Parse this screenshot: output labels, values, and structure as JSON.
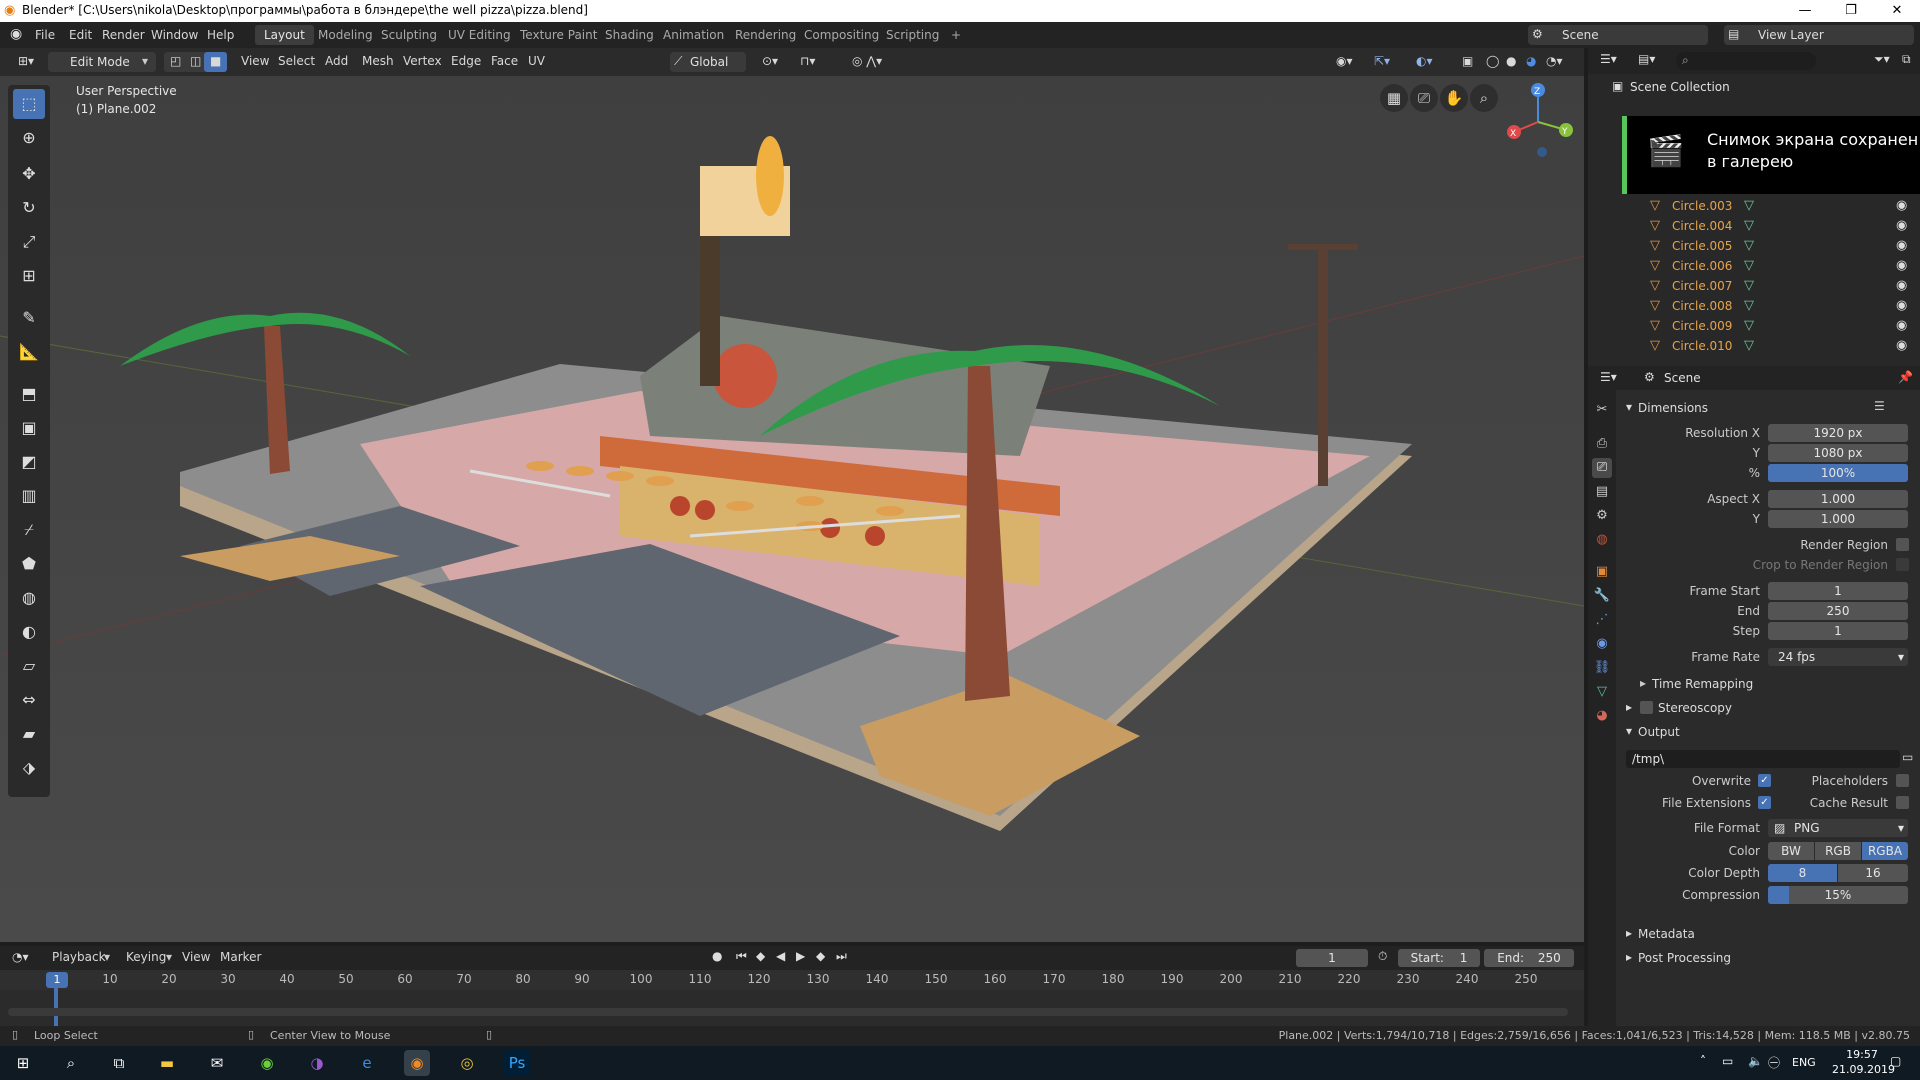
{
  "window": {
    "title": "Blender* [C:\\Users\\nikola\\Desktop\\программы\\работа в блэндере\\the well pizza\\pizza.blend]",
    "minimize": "—",
    "maximize": "❐",
    "close": "✕"
  },
  "topbar": {
    "menus": [
      "File",
      "Edit",
      "Render",
      "Window",
      "Help"
    ],
    "workspaces": [
      "Layout",
      "Modeling",
      "Sculpting",
      "UV Editing",
      "Texture Paint",
      "Shading",
      "Animation",
      "Rendering",
      "Compositing",
      "Scripting"
    ],
    "add_workspace": "+",
    "scene_label": "Scene",
    "view_layer_label": "View Layer"
  },
  "viewport_header": {
    "mode": "Edit Mode",
    "menus": [
      "View",
      "Select",
      "Add",
      "Mesh",
      "Vertex",
      "Edge",
      "Face",
      "UV"
    ],
    "orientation": "Global"
  },
  "viewport": {
    "perspective": "User Perspective",
    "object": "(1) Plane.002",
    "gizmo": {
      "x": "X",
      "y": "Y",
      "z": "Z"
    }
  },
  "outliner": {
    "title": "Scene Collection",
    "items": [
      "Circle.003",
      "Circle.004",
      "Circle.005",
      "Circle.006",
      "Circle.007",
      "Circle.008",
      "Circle.009",
      "Circle.010"
    ]
  },
  "toast": {
    "line1": "Снимок экрана сохранен",
    "line2": "в галерею"
  },
  "properties": {
    "context": "Scene",
    "dimensions": {
      "title": "Dimensions",
      "resolution_x_label": "Resolution X",
      "resolution_x": "1920 px",
      "y_label": "Y",
      "resolution_y": "1080 px",
      "percent_label": "%",
      "percent": "100%",
      "aspect_x_label": "Aspect X",
      "aspect_x": "1.000",
      "aspect_y": "1.000",
      "render_region": "Render Region",
      "crop_region": "Crop to Render Region",
      "frame_start_label": "Frame Start",
      "frame_start": "1",
      "end_label": "End",
      "frame_end": "250",
      "step_label": "Step",
      "step": "1",
      "frame_rate_label": "Frame Rate",
      "frame_rate": "24 fps",
      "time_remapping": "Time Remapping"
    },
    "stereoscopy": "Stereoscopy",
    "output": {
      "title": "Output",
      "path": "/tmp\\",
      "overwrite": "Overwrite",
      "placeholders": "Placeholders",
      "file_extensions": "File Extensions",
      "cache_result": "Cache Result",
      "file_format_label": "File Format",
      "file_format": "PNG",
      "color_label": "Color",
      "color_options": [
        "BW",
        "RGB",
        "RGBA"
      ],
      "color_depth_label": "Color Depth",
      "color_depth_options": [
        "8",
        "16"
      ],
      "compression_label": "Compression",
      "compression": "15%",
      "compression_value": 0.15
    },
    "metadata": "Metadata",
    "post_processing": "Post Processing"
  },
  "timeline": {
    "menus": [
      "Playback",
      "Keying",
      "View",
      "Marker"
    ],
    "current_frame": "1",
    "start_label": "Start:",
    "start": "1",
    "end_label": "End:",
    "end": "250",
    "ticks": [
      "1",
      "10",
      "20",
      "30",
      "40",
      "50",
      "60",
      "70",
      "80",
      "90",
      "100",
      "110",
      "120",
      "130",
      "140",
      "150",
      "160",
      "170",
      "180",
      "190",
      "200",
      "210",
      "220",
      "230",
      "240",
      "250"
    ]
  },
  "statusbar": {
    "left1": "Loop Select",
    "left2": "Center View to Mouse",
    "stats": "Plane.002 | Verts:1,794/10,718 | Edges:2,759/16,656 | Faces:1,041/6,523 | Tris:14,528 | Mem: 118.5 MB | v2.80.75"
  },
  "taskbar": {
    "lang": "ENG",
    "time": "19:57",
    "date": "21.09.2019"
  },
  "colors": {
    "accent": "#4772b3",
    "outliner_item": "#e8a44a",
    "toast_border": "#56c75b"
  }
}
